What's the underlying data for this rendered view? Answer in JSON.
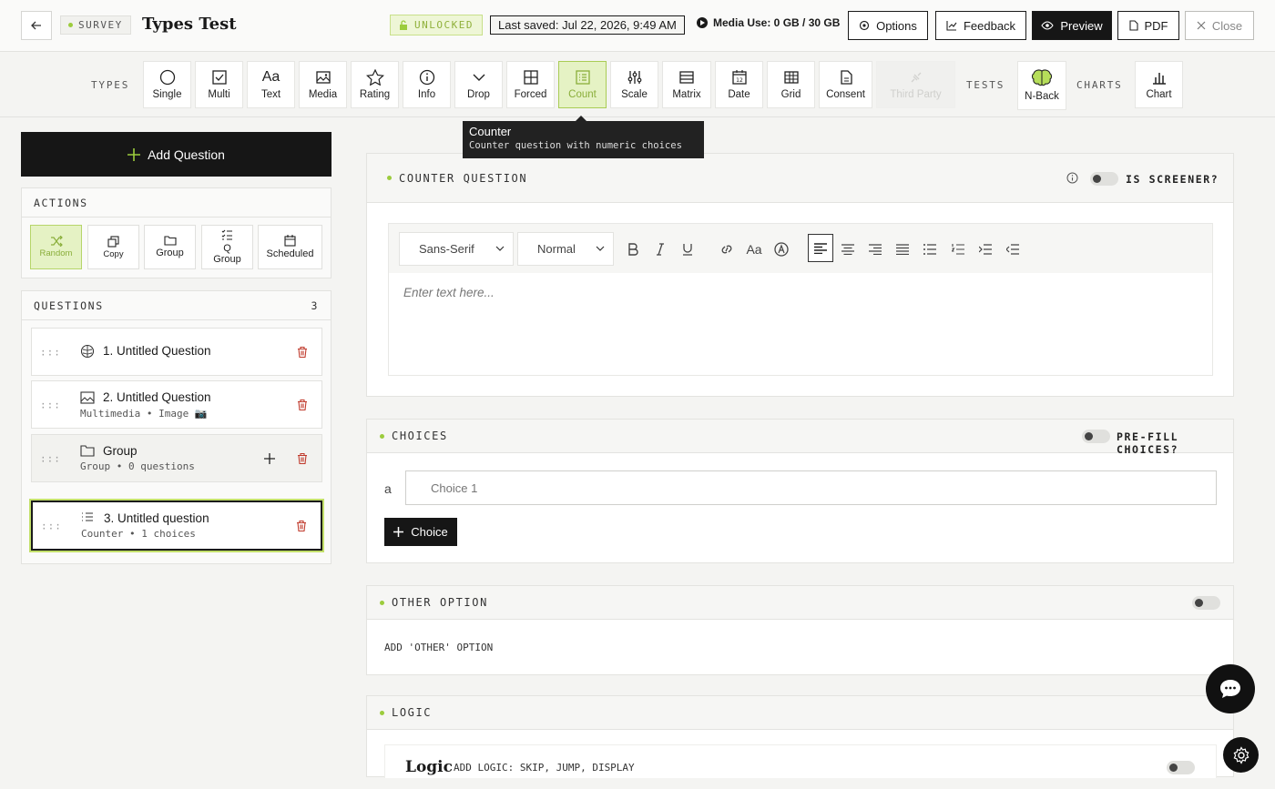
{
  "header": {
    "survey_tag": "SURVEY",
    "title": "Types Test",
    "lock_status": "UNLOCKED",
    "last_saved": "Last saved: Jul 22, 2026, 9:49 AM",
    "media_use": "Media Use: 0 GB / 30 GB",
    "options": "Options",
    "feedback": "Feedback",
    "preview": "Preview",
    "pdf": "PDF",
    "close": "Close"
  },
  "typesbar": {
    "types_label": "TYPES",
    "tests_label": "TESTS",
    "charts_label": "CHARTS",
    "types": [
      {
        "label": "Single",
        "icon": "circle-icon"
      },
      {
        "label": "Multi",
        "icon": "checkbox-icon"
      },
      {
        "label": "Text",
        "icon": "text-icon"
      },
      {
        "label": "Media",
        "icon": "image-icon"
      },
      {
        "label": "Rating",
        "icon": "star-icon"
      },
      {
        "label": "Info",
        "icon": "info-icon"
      },
      {
        "label": "Drop",
        "icon": "chevron-down-icon"
      },
      {
        "label": "Forced",
        "icon": "grid-icon"
      },
      {
        "label": "Count",
        "icon": "list-ordered-icon"
      },
      {
        "label": "Scale",
        "icon": "sliders-icon"
      },
      {
        "label": "Matrix",
        "icon": "table-icon"
      },
      {
        "label": "Date",
        "icon": "calendar-icon"
      },
      {
        "label": "Grid",
        "icon": "grid-table-icon"
      },
      {
        "label": "Consent",
        "icon": "document-icon"
      },
      {
        "label": "Third Party",
        "icon": "plug-icon"
      }
    ],
    "tests": [
      {
        "label": "N-Back",
        "icon": "brain-icon"
      }
    ],
    "charts": [
      {
        "label": "Chart",
        "icon": "bar-chart-icon"
      }
    ]
  },
  "tooltip": {
    "title": "Counter",
    "description": "Counter question with numeric choices"
  },
  "sidebar": {
    "add_question": "Add Question",
    "actions_label": "ACTIONS",
    "actions": [
      {
        "label": "Random",
        "icon": "shuffle-icon"
      },
      {
        "label": "Copy",
        "icon": "copy-icon"
      },
      {
        "label": "Group",
        "icon": "folder-icon"
      },
      {
        "label": "Q\nGroup",
        "icon": "list-check-icon"
      },
      {
        "label": "Scheduled",
        "icon": "calendar-icon"
      }
    ],
    "questions_label": "QUESTIONS",
    "questions_count": "3",
    "questions": [
      {
        "title": "1. Untitled Question",
        "subtitle": "",
        "icon": "brain-icon"
      },
      {
        "title": "2. Untitled Question",
        "subtitle": "Multimedia • Image 📷",
        "icon": "image-icon"
      },
      {
        "title": "Group",
        "subtitle": "Group • 0 questions",
        "icon": "folder-icon"
      },
      {
        "title": "3. Untitled question",
        "subtitle": "Counter • 1 choices",
        "icon": "list-ordered-icon"
      }
    ],
    "drag_glyph": ":::"
  },
  "main": {
    "counter_card": {
      "title": "COUNTER QUESTION",
      "screener_label": "IS SCREENER?",
      "font_select": "Sans-Serif",
      "size_select": "Normal",
      "placeholder": "Enter text here..."
    },
    "choices_card": {
      "title": "CHOICES",
      "prefill_label": "PRE-FILL CHOICES?",
      "choice_letter": "a",
      "choice_placeholder": "Choice 1",
      "add_choice": "Choice"
    },
    "other_card": {
      "title": "OTHER OPTION",
      "add_other": "ADD 'OTHER' OPTION"
    },
    "logic_card": {
      "title": "LOGIC",
      "logic_heading": "Logic",
      "logic_desc": "ADD LOGIC: SKIP, JUMP, DISPLAY"
    }
  },
  "colors": {
    "accent_green": "#9ccc3d",
    "dark": "#161616",
    "delete_red": "#c0392b"
  }
}
